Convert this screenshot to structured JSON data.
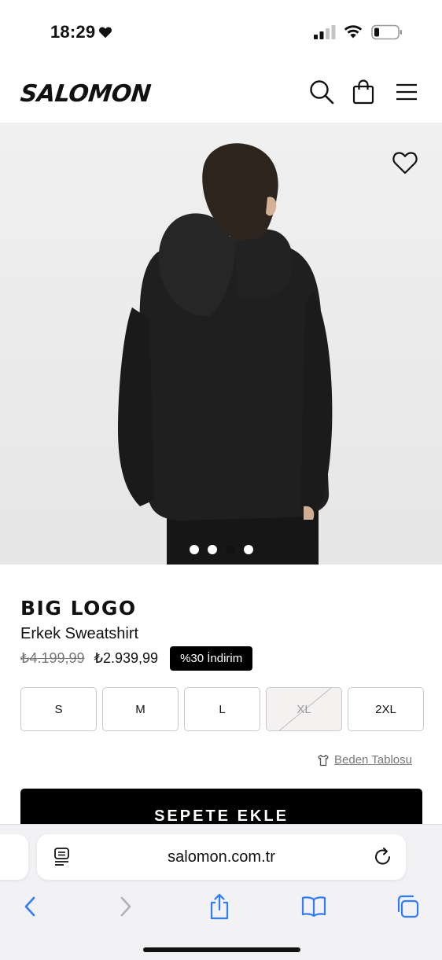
{
  "status_bar": {
    "time": "18:29"
  },
  "header": {
    "brand": "SALOMON",
    "icons": [
      "search-icon",
      "shopping-bag-icon",
      "hamburger-menu-icon"
    ]
  },
  "gallery": {
    "slide_count": 4,
    "active_slide": 3,
    "wishlist_icon": "heart-outline-icon"
  },
  "product": {
    "name": "BIG LOGO",
    "subtitle": "Erkek Sweatshirt",
    "price_old": "₺4.199,99",
    "price_new": "₺2.939,99",
    "discount": "%30 İndirim"
  },
  "sizes": [
    {
      "label": "S",
      "available": true
    },
    {
      "label": "M",
      "available": true
    },
    {
      "label": "L",
      "available": true
    },
    {
      "label": "XL",
      "available": false
    },
    {
      "label": "2XL",
      "available": true
    }
  ],
  "size_chart_link": "Beden Tablosu",
  "add_to_cart_label": "SEPETE EKLE",
  "browser": {
    "url": "salomon.com.tr",
    "toolbar_icons": [
      "back-icon",
      "forward-icon",
      "share-icon",
      "bookmarks-icon",
      "tabs-icon"
    ]
  },
  "colors": {
    "accent": "#000000",
    "badge_bg": "#000000",
    "disabled_size_bg": "#f4f1f1"
  }
}
